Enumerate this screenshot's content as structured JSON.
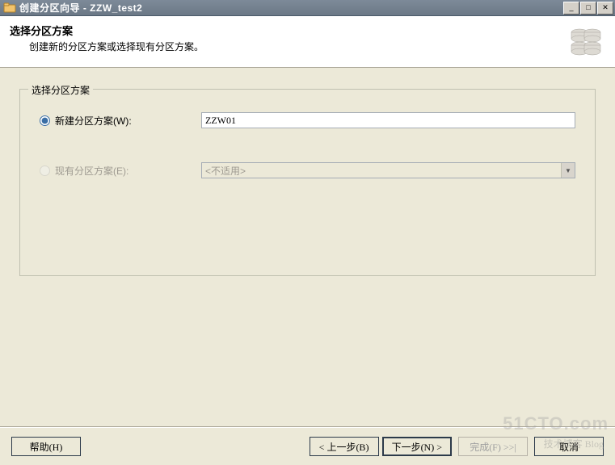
{
  "window": {
    "title": "创建分区向导 - ZZW_test2"
  },
  "header": {
    "title": "选择分区方案",
    "subtitle": "创建新的分区方案或选择现有分区方案。"
  },
  "group": {
    "legend": "选择分区方案",
    "new_label": "新建分区方案(W):",
    "new_value": "ZZW01",
    "existing_label": "现有分区方案(E):",
    "existing_value": "<不适用>"
  },
  "footer": {
    "help": "帮助(H)",
    "back": "< 上一步(B)",
    "next": "下一步(N) >",
    "finish": "完成(F) >>|",
    "cancel": "取消"
  },
  "watermark": {
    "main": "51CTO.com",
    "sub": "技术博客  Blog"
  }
}
